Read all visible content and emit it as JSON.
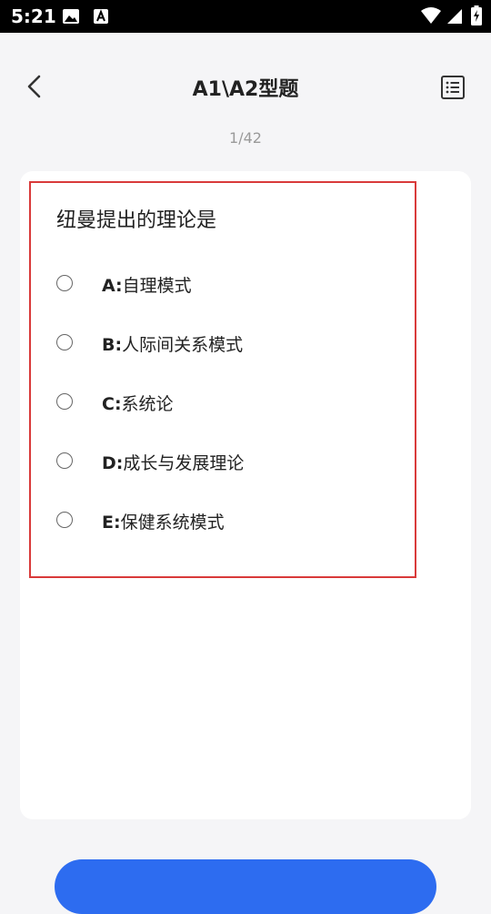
{
  "status_bar": {
    "time": "5:21"
  },
  "header": {
    "title": "A1\\A2型题",
    "progress": "1/42"
  },
  "question": {
    "text": "纽曼提出的理论是",
    "options": [
      {
        "letter": "A:",
        "text": "自理模式"
      },
      {
        "letter": "B:",
        "text": "人际间关系模式"
      },
      {
        "letter": "C:",
        "text": "系统论"
      },
      {
        "letter": "D:",
        "text": "成长与发展理论"
      },
      {
        "letter": "E:",
        "text": "保健系统模式"
      }
    ]
  },
  "colors": {
    "accent": "#2d6cf0",
    "highlight_border": "#d93a3a",
    "background": "#f5f5f7"
  }
}
